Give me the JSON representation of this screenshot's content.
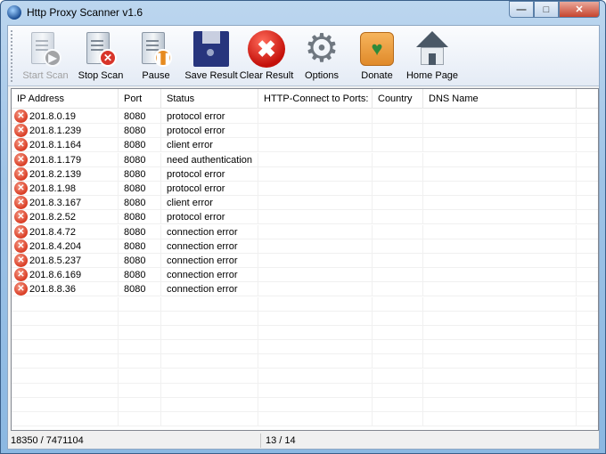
{
  "window": {
    "title": "Http Proxy Scanner v1.6",
    "minimize": "—",
    "maximize": "□",
    "close": "✕"
  },
  "toolbar": [
    {
      "label": "Start Scan",
      "icon": "start-scan-icon",
      "enabled": false
    },
    {
      "label": "Stop Scan",
      "icon": "stop-scan-icon",
      "enabled": true
    },
    {
      "label": "Pause",
      "icon": "pause-icon",
      "enabled": true
    },
    {
      "label": "Save Result",
      "icon": "floppy-disk-icon",
      "enabled": true
    },
    {
      "label": "Clear Result",
      "icon": "clear-icon",
      "enabled": true
    },
    {
      "label": "Options",
      "icon": "gear-icon",
      "enabled": true
    },
    {
      "label": "Donate",
      "icon": "donate-hand-icon",
      "enabled": true
    },
    {
      "label": "Home Page",
      "icon": "home-icon",
      "enabled": true
    }
  ],
  "columns": [
    "IP Address",
    "Port",
    "Status",
    "HTTP-Connect to Ports:",
    "Country",
    "DNS Name"
  ],
  "rows": [
    [
      "201.8.0.19",
      "8080",
      "protocol error"
    ],
    [
      "201.8.1.239",
      "8080",
      "protocol error"
    ],
    [
      "201.8.1.164",
      "8080",
      "client error"
    ],
    [
      "201.8.1.179",
      "8080",
      "need authentication"
    ],
    [
      "201.8.2.139",
      "8080",
      "protocol error"
    ],
    [
      "201.8.1.98",
      "8080",
      "protocol error"
    ],
    [
      "201.8.3.167",
      "8080",
      "client error"
    ],
    [
      "201.8.2.52",
      "8080",
      "protocol error"
    ],
    [
      "201.8.4.72",
      "8080",
      "connection error"
    ],
    [
      "201.8.4.204",
      "8080",
      "connection error"
    ],
    [
      "201.8.5.237",
      "8080",
      "connection error"
    ],
    [
      "201.8.6.169",
      "8080",
      "connection error"
    ],
    [
      "201.8.8.36",
      "8080",
      "connection error"
    ]
  ],
  "statusbar": {
    "progress": "18350 / 7471104",
    "found": "13 / 14"
  }
}
